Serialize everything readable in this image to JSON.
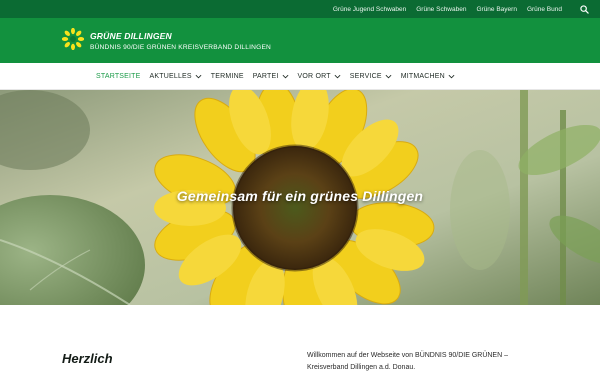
{
  "topbar": {
    "links": [
      "Grüne Jugend Schwaben",
      "Grüne Schwaben",
      "Grüne Bayern",
      "Grüne Bund"
    ],
    "search_icon": "search-icon"
  },
  "brand": {
    "title": "GRÜNE DILLINGEN",
    "subtitle": "BÜNDNIS 90/DIE GRÜNEN KREISVERBAND DILLINGEN",
    "logo_icon": "sunflower-logo-icon"
  },
  "nav": {
    "items": [
      {
        "label": "STARTSEITE",
        "active": true,
        "dropdown": false
      },
      {
        "label": "AKTUELLES",
        "active": false,
        "dropdown": true
      },
      {
        "label": "TERMINE",
        "active": false,
        "dropdown": false
      },
      {
        "label": "PARTEI",
        "active": false,
        "dropdown": true
      },
      {
        "label": "VOR ORT",
        "active": false,
        "dropdown": true
      },
      {
        "label": "SERVICE",
        "active": false,
        "dropdown": true
      },
      {
        "label": "MITMACHEN",
        "active": false,
        "dropdown": true
      }
    ]
  },
  "hero": {
    "title": "Gemeinsam für ein grünes Dillingen"
  },
  "content": {
    "heading": "Herzlich",
    "welcome_line1": "Willkommen auf der Webseite von BÜNDNIS 90/DIE GRÜNEN –",
    "welcome_line2": "Kreisverband Dillingen a.d. Donau."
  },
  "colors": {
    "topbar": "#0b6b33",
    "brandbar": "#12913e",
    "nav_active": "#1b9b48",
    "sunflower": "#f2cf1d"
  }
}
